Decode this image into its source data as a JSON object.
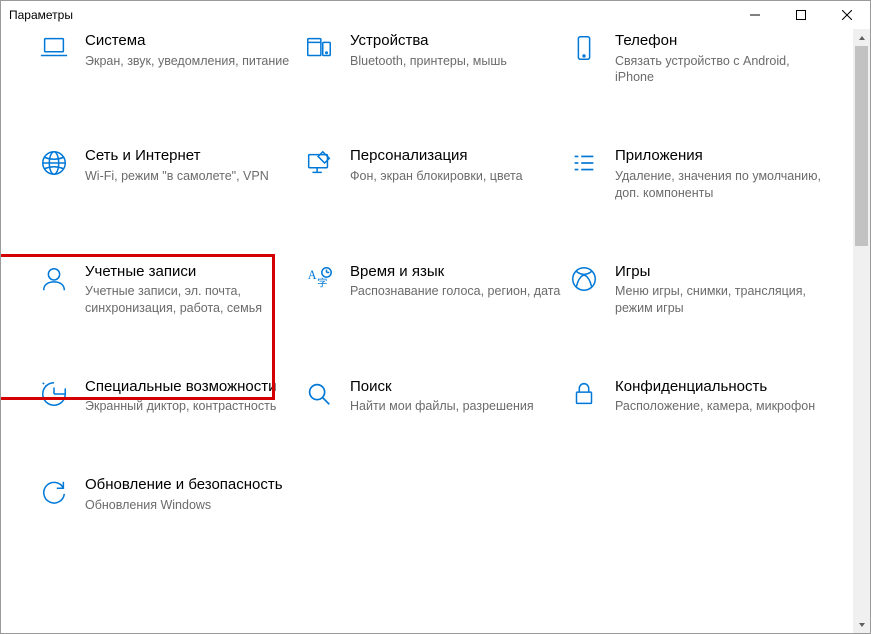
{
  "window": {
    "title": "Параметры"
  },
  "tiles": [
    {
      "id": "system",
      "title": "Система",
      "sub": "Экран, звук, уведомления, питание"
    },
    {
      "id": "devices",
      "title": "Устройства",
      "sub": "Bluetooth, принтеры, мышь"
    },
    {
      "id": "phone",
      "title": "Телефон",
      "sub": "Связать устройство с Android, iPhone"
    },
    {
      "id": "network",
      "title": "Сеть и Интернет",
      "sub": "Wi-Fi, режим \"в самолете\", VPN"
    },
    {
      "id": "personalization",
      "title": "Персонализация",
      "sub": "Фон, экран блокировки, цвета"
    },
    {
      "id": "apps",
      "title": "Приложения",
      "sub": "Удаление, значения по умолчанию, доп. компоненты"
    },
    {
      "id": "accounts",
      "title": "Учетные записи",
      "sub": "Учетные записи, эл. почта, синхронизация, работа, семья"
    },
    {
      "id": "time",
      "title": "Время и язык",
      "sub": "Распознавание голоса, регион, дата"
    },
    {
      "id": "gaming",
      "title": "Игры",
      "sub": "Меню игры, снимки, трансляция, режим игры"
    },
    {
      "id": "ease",
      "title": "Специальные возможности",
      "sub": "Экранный диктор, контрастность"
    },
    {
      "id": "search",
      "title": "Поиск",
      "sub": "Найти мои файлы, разрешения"
    },
    {
      "id": "privacy",
      "title": "Конфиденциальность",
      "sub": "Расположение, камера, микрофон"
    },
    {
      "id": "update",
      "title": "Обновление и безопасность",
      "sub": "Обновления Windows"
    }
  ]
}
